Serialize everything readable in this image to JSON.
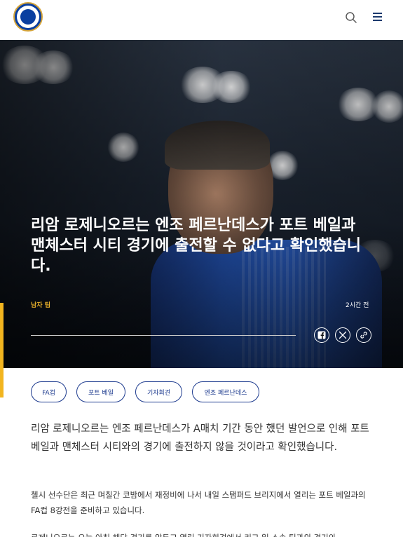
{
  "header": {
    "logo_icon": "chelsea-crest",
    "search_icon": "search-icon",
    "menu_icon": "hamburger-menu-icon"
  },
  "hero": {
    "headline": "리암 로제니오르는 엔조 페르난데스가 포트 베일과 맨체스터 시티 경기에 출전할 수 없다고 확인했습니다.",
    "category": "남자 팀",
    "time": "2시간 전",
    "share_icons": [
      "facebook-icon",
      "x-icon",
      "link-icon"
    ]
  },
  "tags": [
    "FA컵",
    "포트 베일",
    "기자회견",
    "엔조 페르난데스"
  ],
  "article": {
    "lead": "리암 로제니오르는 엔조 페르난데스가 A매치 기간 동안 했던 발언으로 인해 포트 베일과 맨체스터 시티와의 경기에 출전하지 않을 것이라고 확인했습니다.",
    "para1": "첼시 선수단은 최근 며칠간 코밤에서 재정비에 나서 내일 스탬퍼드 브리지에서 열리는 포트 베일과의 FA컵 8강전을 준비하고 있습니다.",
    "para2": "로제니오르는 오늘 아침 해당 경기를 앞두고 열린 기자회견에서 리그 일 소속 팀과의 경기와"
  },
  "colors": {
    "accent": "#f2b51f",
    "brand_blue": "#1c3a8e",
    "category_gold": "#e8b02b"
  }
}
